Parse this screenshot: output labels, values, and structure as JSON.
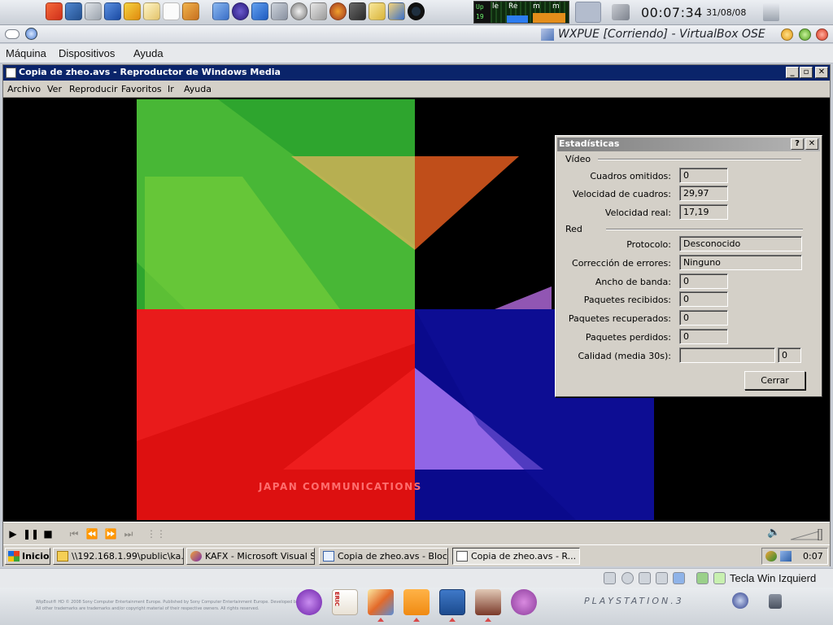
{
  "host_panel": {
    "launchers": [
      "rocket-icon",
      "home-icon",
      "wifi-icon",
      "kde-icon",
      "download-icon",
      "notepad-icon",
      "blank-icon",
      "wrench-icon",
      "upload-icon",
      "cross-icon",
      "down-arrow-icon",
      "terminal-icon",
      "disc-icon",
      "camera-icon",
      "gear-icon",
      "headphones-icon",
      "k-icon",
      "contacts-icon",
      "q-icon"
    ],
    "monitor_up": "Up",
    "monitor_up_value": "19",
    "monitor_labels": [
      "le",
      "Re",
      "m",
      "m"
    ],
    "clock": "00:07:34",
    "date": "31/08/08"
  },
  "vbox": {
    "title": "WXPUE [Corriendo] - VirtualBox OSE",
    "menu": [
      "Máquina",
      "Dispositivos",
      "Ayuda"
    ],
    "status_hostkey": "Tecla Win Izquierd"
  },
  "wmp": {
    "title": "Copia de zheo.avs - Reproductor de Windows Media",
    "menu": [
      "Archivo",
      "Ver",
      "Reproducir",
      "Favoritos",
      "Ir",
      "Ayuda"
    ],
    "video_caption": "JAPAN COMMUNICATIONS"
  },
  "stats": {
    "title": "Estadísticas",
    "help_btn": "?",
    "close_x": "✕",
    "video_group": "Vídeo",
    "net_group": "Red",
    "fields": {
      "frames_skipped": {
        "label": "Cuadros omitidos:",
        "value": "0"
      },
      "frame_rate": {
        "label": "Velocidad de cuadros:",
        "value": "29,97"
      },
      "actual_rate": {
        "label": "Velocidad real:",
        "value": "17,19"
      },
      "protocol": {
        "label": "Protocolo:",
        "value": "Desconocido"
      },
      "error_correction": {
        "label": "Corrección de errores:",
        "value": "Ninguno"
      },
      "bandwidth": {
        "label": "Ancho de banda:",
        "value": "0"
      },
      "packets_received": {
        "label": "Paquetes recibidos:",
        "value": "0"
      },
      "packets_recovered": {
        "label": "Paquetes recuperados:",
        "value": "0"
      },
      "packets_lost": {
        "label": "Paquetes perdidos:",
        "value": "0"
      },
      "quality": {
        "label": "Calidad (media 30s):",
        "value": "0"
      }
    },
    "close_label": "Cerrar"
  },
  "taskbar": {
    "start": "Inicio",
    "tasks": [
      {
        "label": "\\\\192.168.1.99\\public\\ka..."
      },
      {
        "label": "KAFX - Microsoft Visual S..."
      },
      {
        "label": "Copia de zheo.avs - Bloc..."
      },
      {
        "label": "Copia de zheo.avs - R..."
      }
    ],
    "clock": "0:07"
  },
  "host_dock": {
    "wallpaper_line1": "WipEout® HD © 2008 Sony Computer Entertainment Europe. Published by Sony Computer Entertainment Europe. Developed by SCE",
    "wallpaper_line2": "All other trademarks are trademarks and/or copyright material of their respective owners. All rights reserved.",
    "ps3": "PLAYSTATION.3",
    "eric_label": "ERIC",
    "icons": [
      "vlc-v-icon",
      "eric-icon",
      "butterfly-icon",
      "folder-icon",
      "system-monitor-icon",
      "anime-avatar-icon",
      "lastfm-icon"
    ]
  },
  "colors": {
    "wmp_title": "#0a246a",
    "win_face": "#d4d0c8",
    "video_green": "#2ea52e",
    "video_red": "#dd1010",
    "video_blue": "#0a0a8c"
  }
}
